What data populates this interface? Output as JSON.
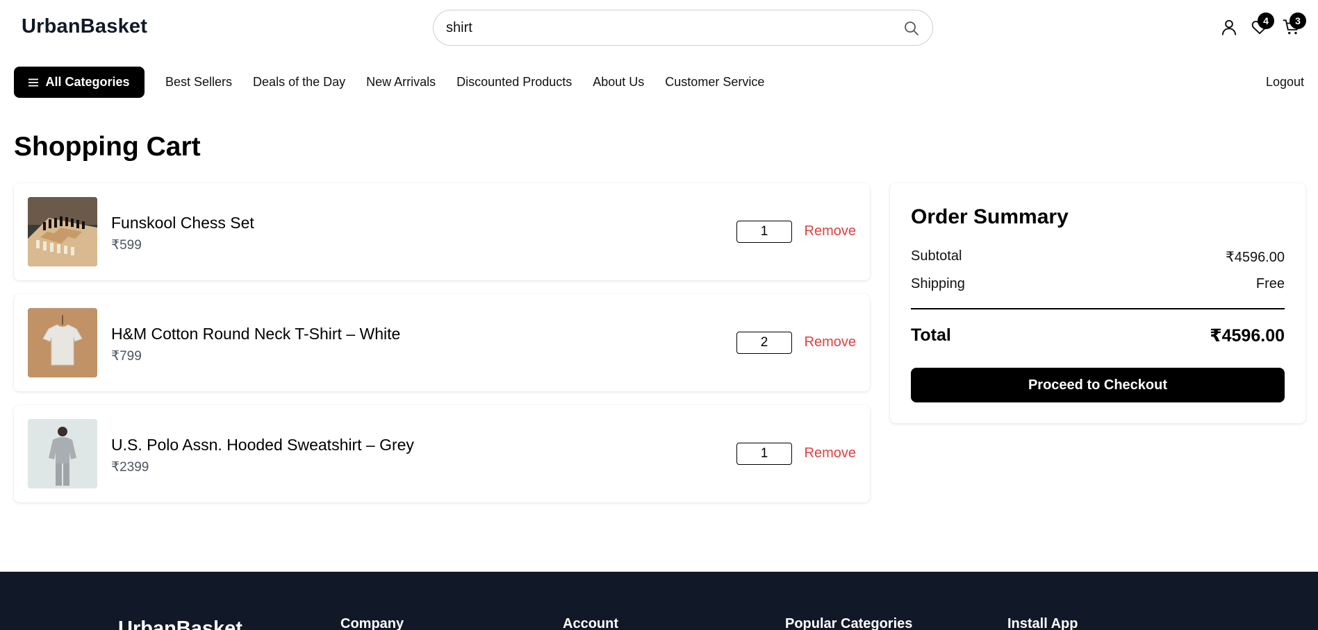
{
  "header": {
    "logo": "UrbanBasket",
    "search": {
      "value": "shirt",
      "placeholder": ""
    },
    "wishlist_count": "4",
    "cart_count": "3"
  },
  "nav": {
    "all_categories": "All Categories",
    "links": [
      "Best Sellers",
      "Deals of the Day",
      "New Arrivals",
      "Discounted Products",
      "About Us",
      "Customer Service"
    ],
    "logout": "Logout"
  },
  "page_title": "Shopping Cart",
  "cart": {
    "items": [
      {
        "name": "Funskool Chess Set",
        "price": "₹599",
        "qty": "1",
        "remove": "Remove"
      },
      {
        "name": "H&M Cotton Round Neck T-Shirt – White",
        "price": "₹799",
        "qty": "2",
        "remove": "Remove"
      },
      {
        "name": "U.S. Polo Assn. Hooded Sweatshirt – Grey",
        "price": "₹2399",
        "qty": "1",
        "remove": "Remove"
      }
    ]
  },
  "summary": {
    "title": "Order Summary",
    "subtotal_label": "Subtotal",
    "subtotal_value": "₹4596.00",
    "shipping_label": "Shipping",
    "shipping_value": "Free",
    "total_label": "Total",
    "total_value": "₹4596.00",
    "checkout_label": "Proceed to Checkout"
  },
  "footer": {
    "logo": "UrbanBasket",
    "columns": [
      "Company",
      "Account",
      "Popular Categories",
      "Install App"
    ]
  },
  "colors": {
    "accent": "#000000",
    "remove": "#e53e3e",
    "footer_bg": "#111827"
  }
}
